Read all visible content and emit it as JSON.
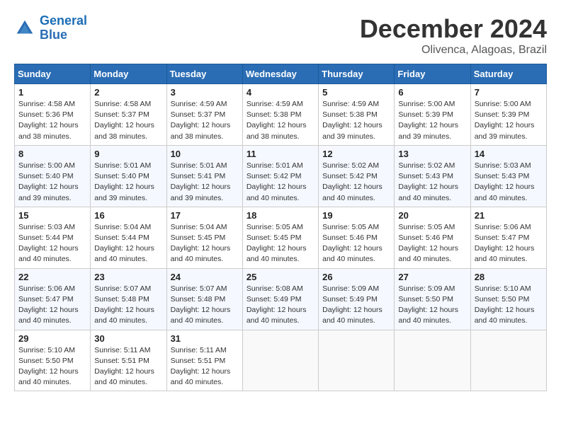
{
  "header": {
    "logo_line1": "General",
    "logo_line2": "Blue",
    "month": "December 2024",
    "location": "Olivenca, Alagoas, Brazil"
  },
  "weekdays": [
    "Sunday",
    "Monday",
    "Tuesday",
    "Wednesday",
    "Thursday",
    "Friday",
    "Saturday"
  ],
  "weeks": [
    [
      {
        "day": "1",
        "info": "Sunrise: 4:58 AM\nSunset: 5:36 PM\nDaylight: 12 hours\nand 38 minutes."
      },
      {
        "day": "2",
        "info": "Sunrise: 4:58 AM\nSunset: 5:37 PM\nDaylight: 12 hours\nand 38 minutes."
      },
      {
        "day": "3",
        "info": "Sunrise: 4:59 AM\nSunset: 5:37 PM\nDaylight: 12 hours\nand 38 minutes."
      },
      {
        "day": "4",
        "info": "Sunrise: 4:59 AM\nSunset: 5:38 PM\nDaylight: 12 hours\nand 38 minutes."
      },
      {
        "day": "5",
        "info": "Sunrise: 4:59 AM\nSunset: 5:38 PM\nDaylight: 12 hours\nand 39 minutes."
      },
      {
        "day": "6",
        "info": "Sunrise: 5:00 AM\nSunset: 5:39 PM\nDaylight: 12 hours\nand 39 minutes."
      },
      {
        "day": "7",
        "info": "Sunrise: 5:00 AM\nSunset: 5:39 PM\nDaylight: 12 hours\nand 39 minutes."
      }
    ],
    [
      {
        "day": "8",
        "info": "Sunrise: 5:00 AM\nSunset: 5:40 PM\nDaylight: 12 hours\nand 39 minutes."
      },
      {
        "day": "9",
        "info": "Sunrise: 5:01 AM\nSunset: 5:40 PM\nDaylight: 12 hours\nand 39 minutes."
      },
      {
        "day": "10",
        "info": "Sunrise: 5:01 AM\nSunset: 5:41 PM\nDaylight: 12 hours\nand 39 minutes."
      },
      {
        "day": "11",
        "info": "Sunrise: 5:01 AM\nSunset: 5:42 PM\nDaylight: 12 hours\nand 40 minutes."
      },
      {
        "day": "12",
        "info": "Sunrise: 5:02 AM\nSunset: 5:42 PM\nDaylight: 12 hours\nand 40 minutes."
      },
      {
        "day": "13",
        "info": "Sunrise: 5:02 AM\nSunset: 5:43 PM\nDaylight: 12 hours\nand 40 minutes."
      },
      {
        "day": "14",
        "info": "Sunrise: 5:03 AM\nSunset: 5:43 PM\nDaylight: 12 hours\nand 40 minutes."
      }
    ],
    [
      {
        "day": "15",
        "info": "Sunrise: 5:03 AM\nSunset: 5:44 PM\nDaylight: 12 hours\nand 40 minutes."
      },
      {
        "day": "16",
        "info": "Sunrise: 5:04 AM\nSunset: 5:44 PM\nDaylight: 12 hours\nand 40 minutes."
      },
      {
        "day": "17",
        "info": "Sunrise: 5:04 AM\nSunset: 5:45 PM\nDaylight: 12 hours\nand 40 minutes."
      },
      {
        "day": "18",
        "info": "Sunrise: 5:05 AM\nSunset: 5:45 PM\nDaylight: 12 hours\nand 40 minutes."
      },
      {
        "day": "19",
        "info": "Sunrise: 5:05 AM\nSunset: 5:46 PM\nDaylight: 12 hours\nand 40 minutes."
      },
      {
        "day": "20",
        "info": "Sunrise: 5:05 AM\nSunset: 5:46 PM\nDaylight: 12 hours\nand 40 minutes."
      },
      {
        "day": "21",
        "info": "Sunrise: 5:06 AM\nSunset: 5:47 PM\nDaylight: 12 hours\nand 40 minutes."
      }
    ],
    [
      {
        "day": "22",
        "info": "Sunrise: 5:06 AM\nSunset: 5:47 PM\nDaylight: 12 hours\nand 40 minutes."
      },
      {
        "day": "23",
        "info": "Sunrise: 5:07 AM\nSunset: 5:48 PM\nDaylight: 12 hours\nand 40 minutes."
      },
      {
        "day": "24",
        "info": "Sunrise: 5:07 AM\nSunset: 5:48 PM\nDaylight: 12 hours\nand 40 minutes."
      },
      {
        "day": "25",
        "info": "Sunrise: 5:08 AM\nSunset: 5:49 PM\nDaylight: 12 hours\nand 40 minutes."
      },
      {
        "day": "26",
        "info": "Sunrise: 5:09 AM\nSunset: 5:49 PM\nDaylight: 12 hours\nand 40 minutes."
      },
      {
        "day": "27",
        "info": "Sunrise: 5:09 AM\nSunset: 5:50 PM\nDaylight: 12 hours\nand 40 minutes."
      },
      {
        "day": "28",
        "info": "Sunrise: 5:10 AM\nSunset: 5:50 PM\nDaylight: 12 hours\nand 40 minutes."
      }
    ],
    [
      {
        "day": "29",
        "info": "Sunrise: 5:10 AM\nSunset: 5:50 PM\nDaylight: 12 hours\nand 40 minutes."
      },
      {
        "day": "30",
        "info": "Sunrise: 5:11 AM\nSunset: 5:51 PM\nDaylight: 12 hours\nand 40 minutes."
      },
      {
        "day": "31",
        "info": "Sunrise: 5:11 AM\nSunset: 5:51 PM\nDaylight: 12 hours\nand 40 minutes."
      },
      null,
      null,
      null,
      null
    ]
  ]
}
